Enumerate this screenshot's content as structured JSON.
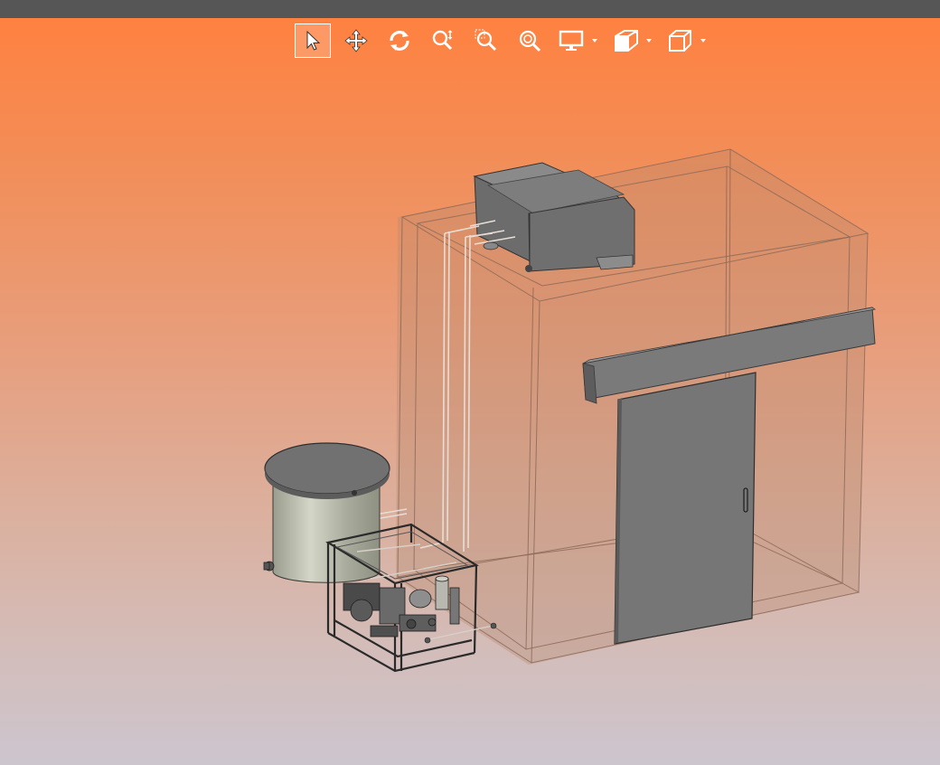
{
  "window": {
    "title_bar_color": "#565656"
  },
  "viewport": {
    "background_top": "#ff8140",
    "background_bottom": "#cdc5ce"
  },
  "toolbar": {
    "buttons": [
      {
        "id": "select",
        "icon": "cursor-arrow-icon",
        "active": true,
        "dropdown": false
      },
      {
        "id": "pan",
        "icon": "move-arrows-icon",
        "active": false,
        "dropdown": false
      },
      {
        "id": "rotate",
        "icon": "rotate-icon",
        "active": false,
        "dropdown": false
      },
      {
        "id": "zoom",
        "icon": "zoom-dynamic-icon",
        "active": false,
        "dropdown": false
      },
      {
        "id": "zoom-window",
        "icon": "zoom-window-icon",
        "active": false,
        "dropdown": false
      },
      {
        "id": "zoom-fit",
        "icon": "zoom-fit-icon",
        "active": false,
        "dropdown": false
      },
      {
        "id": "display",
        "icon": "monitor-icon",
        "active": false,
        "dropdown": true
      },
      {
        "id": "section",
        "icon": "section-cut-icon",
        "active": false,
        "dropdown": true
      },
      {
        "id": "view-orientation",
        "icon": "cube-view-icon",
        "active": false,
        "dropdown": true
      }
    ]
  },
  "model": {
    "components": [
      "enclosure-room",
      "roof-condensing-unit",
      "sliding-door",
      "door-rail",
      "storage-tank",
      "pump-skid",
      "piping"
    ],
    "colors": {
      "enclosure_fill": "#b88a70",
      "solid_gray": "#6e6e6e",
      "tank_body": "#b4b6a8"
    }
  }
}
